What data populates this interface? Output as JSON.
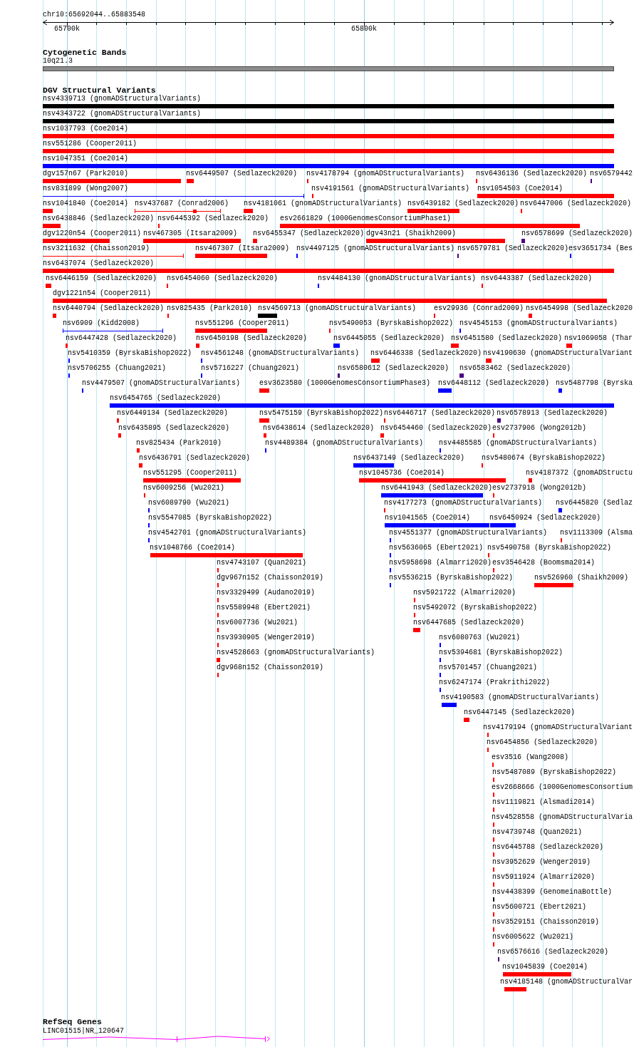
{
  "ruler": {
    "position": "chr10:65692044..65883548",
    "tick_labels": [
      "65700k",
      "65800k"
    ]
  },
  "cytogenetic_bands": {
    "title": "Cytogenetic Bands",
    "band": {
      "label": "10q21.3"
    }
  },
  "dgv_structural_variants": {
    "title": "DGV Structural Variants",
    "rows": [
      {
        "features": [
          {
            "label": "nsv4339713 (gnomADStructuralVariants)",
            "kind": "bar",
            "color": "#000000"
          }
        ]
      },
      {
        "features": [
          {
            "label": "nsv4343722 (gnomADStructuralVariants)",
            "kind": "bar",
            "color": "#000000"
          }
        ]
      },
      {
        "features": [
          {
            "label": "nsv1037793 (Coe2014)",
            "kind": "bar",
            "color": "#ff0000"
          }
        ]
      },
      {
        "features": [
          {
            "label": "nsv551286 (Cooper2011)",
            "kind": "bar",
            "color": "#ff0000"
          }
        ]
      },
      {
        "features": [
          {
            "label": "nsv1047351 (Coe2014)",
            "kind": "bar",
            "color": "#0000ff"
          }
        ]
      },
      {
        "features": [
          {
            "label": "dgv157n67 (Park2010)",
            "kind": "bar",
            "color": "#ff0000"
          },
          {
            "label": "nsv6449507 (Sedlazeck2020)",
            "kind": "bar",
            "color": "#ff0000"
          },
          {
            "label": "nsv4178794 (gnomADStructuralVariants)",
            "kind": "bar",
            "color": "#ff0000"
          },
          {
            "label": "nsv6436136 (Sedlazeck2020)",
            "kind": "bar",
            "color": "#ff0000"
          },
          {
            "label": "nsv6579442",
            "kind": "bar",
            "color": "#4b0082"
          }
        ]
      },
      {
        "features": [
          {
            "label": "nsv831899 (Wong2007)",
            "kind": "span",
            "color": "#0000ff"
          },
          {
            "label": "nsv4191561 (gnomADStructuralVariants)",
            "kind": "bar",
            "color": "#ff0000"
          },
          {
            "label": "nsv1054503 (Coe2014)",
            "kind": "bar",
            "color": "#ff0000"
          }
        ]
      },
      {
        "features": [
          {
            "label": "nsv1041840 (Coe2014)",
            "kind": "bar",
            "color": "#ff0000"
          },
          {
            "label": "nsv437687 (Conrad2006)",
            "kind": "span",
            "color": "#ff0000"
          },
          {
            "label": "nsv4181061 (gnomADStructuralVariants)",
            "kind": "bar",
            "color": "#ff0000"
          },
          {
            "label": "nsv6439182 (Sedlazeck2020)",
            "kind": "bar",
            "color": "#ff0000"
          },
          {
            "label": "nsv6447006 (Sedlazeck2020)",
            "kind": "bar",
            "color": "#ff0000"
          }
        ]
      },
      {
        "features": [
          {
            "label": "nsv6438846 (Sedlazeck2020)",
            "kind": "bar",
            "color": "#ff0000"
          },
          {
            "label": "nsv6445392 (Sedlazeck2020)",
            "kind": "bar",
            "color": "#ff0000"
          },
          {
            "label": "esv2661829 (1000GenomesConsortiumPhase1)",
            "kind": "bar",
            "color": "#ff0000"
          }
        ]
      },
      {
        "features": [
          {
            "label": "dgv1220n54 (Cooper2011)",
            "kind": "bar",
            "color": "#ff0000"
          },
          {
            "label": "nsv467305 (Itsara2009)",
            "kind": "bar",
            "color": "#ff0000"
          },
          {
            "label": "nsv6455347 (Sedlazeck2020)",
            "kind": "bar",
            "color": "#ff0000"
          },
          {
            "label": "dgv43n21 (Shaikh2009)",
            "kind": "bar",
            "color": "#ff0000"
          },
          {
            "label": "nsv6578699 (Sedlazeck2020)",
            "kind": "bar",
            "color": "#4b0082"
          }
        ]
      },
      {
        "features": [
          {
            "label": "nsv3211632 (Chaisson2019)",
            "kind": "span",
            "color": "#ff0000"
          },
          {
            "label": "nsv467307 (Itsara2009)",
            "kind": "bar",
            "color": "#ff0000"
          },
          {
            "label": "nsv4497125 (gnomADStructuralVariants)",
            "kind": "bar",
            "color": "#0000ff"
          },
          {
            "label": "nsv6579781 (Sedlazeck2020)",
            "kind": "bar",
            "color": "#4b0082"
          },
          {
            "label": "esv3651734 (Bes",
            "kind": "bar",
            "color": "#0000ff"
          }
        ]
      },
      {
        "features": [
          {
            "label": "nsv6437074 (Sedlazeck2020)",
            "kind": "bar",
            "color": "#ff0000"
          }
        ]
      },
      {
        "features": [
          {
            "label": "nsv6446159 (Sedlazeck2020)",
            "kind": "bar",
            "color": "#ff0000"
          },
          {
            "label": "nsv6454060 (Sedlazeck2020)",
            "kind": "bar",
            "color": "#ff0000"
          },
          {
            "label": "nsv4484130 (gnomADStructuralVariants)",
            "kind": "bar",
            "color": "#0000ff"
          },
          {
            "label": "nsv6443387 (Sedlazeck2020)",
            "kind": "bar",
            "color": "#ff0000"
          }
        ]
      },
      {
        "features": [
          {
            "label": "dgv1221n54 (Cooper2011)",
            "kind": "bar",
            "color": "#ff0000"
          }
        ]
      },
      {
        "features": [
          {
            "label": "nsv6440794 (Sedlazeck2020)",
            "kind": "bar",
            "color": "#ff0000"
          },
          {
            "label": "nsv825435 (Park2010)",
            "kind": "bar",
            "color": "#ff0000"
          },
          {
            "label": "nsv4569713 (gnomADStructuralVariants)",
            "kind": "bar",
            "color": "#000000"
          },
          {
            "label": "esv29936 (Conrad2009)",
            "kind": "bar",
            "color": "#ff0000"
          },
          {
            "label": "nsv6454998 (Sedlazeck2020",
            "kind": "bar",
            "color": "#ff0000"
          }
        ]
      },
      {
        "features": [
          {
            "label": "nsv6909 (Kidd2008)",
            "kind": "span",
            "color": "#0000ff"
          },
          {
            "label": "nsv551296 (Cooper2011)",
            "kind": "bar",
            "color": "#ff0000"
          },
          {
            "label": "nsv5490053 (ByrskaBishop2022)",
            "kind": "bar",
            "color": "#ff0000"
          },
          {
            "label": "nsv4545153 (gnomADStructuralVariants)",
            "kind": "bar",
            "color": "#0000ff"
          }
        ]
      },
      {
        "features": [
          {
            "label": "nsv6447428 (Sedlazeck2020)",
            "kind": "bar",
            "color": "#ff0000"
          },
          {
            "label": "nsv6450198 (Sedlazeck2020)",
            "kind": "bar",
            "color": "#ff0000"
          },
          {
            "label": "nsv6445055 (Sedlazeck2020)",
            "kind": "bar",
            "color": "#0000ff"
          },
          {
            "label": "nsv6451580 (Sedlazeck2020)",
            "kind": "bar",
            "color": "#ff0000"
          },
          {
            "label": "nsv1069058 (Thar",
            "kind": "bar",
            "color": "#ff0000"
          }
        ]
      },
      {
        "features": [
          {
            "label": "nsv5410359 (ByrskaBishop2022)",
            "kind": "bar",
            "color": "#0000ff"
          },
          {
            "label": "nsv4561248 (gnomADStructuralVariants)",
            "kind": "bar",
            "color": "#0000ff"
          },
          {
            "label": "nsv6446338 (Sedlazeck2020)",
            "kind": "bar",
            "color": "#ff0000"
          },
          {
            "label": "nsv4190630 (gnomADStructuralVariant",
            "kind": "bar",
            "color": "#ff0000"
          }
        ]
      },
      {
        "features": [
          {
            "label": "nsv5706255 (Chuang2021)",
            "kind": "bar",
            "color": "#0000ff"
          },
          {
            "label": "nsv5716227 (Chuang2021)",
            "kind": "bar",
            "color": "#0000ff"
          },
          {
            "label": "nsv6580612 (Sedlazeck2020)",
            "kind": "bar",
            "color": "#4b0082"
          },
          {
            "label": "nsv6583462 (Sedlazeck2020)",
            "kind": "bar",
            "color": "#4b0082"
          }
        ]
      },
      {
        "features": [
          {
            "label": "nsv4479507 (gnomADStructuralVariants)",
            "kind": "bar",
            "color": "#0000ff"
          },
          {
            "label": "esv3623580 (1000GenomesConsortiumPhase3)",
            "kind": "bar",
            "color": "#ff0000"
          },
          {
            "label": "nsv6448112 (Sedlazeck2020)",
            "kind": "bar",
            "color": "#0000ff"
          },
          {
            "label": "nsv5487798 (Byrska",
            "kind": "bar",
            "color": "#0000ff"
          }
        ]
      },
      {
        "features": [
          {
            "label": "nsv6454765 (Sedlazeck2020)",
            "kind": "bar",
            "color": "#0000ff"
          }
        ]
      },
      {
        "features": [
          {
            "label": "nsv6449134 (Sedlazeck2020)",
            "kind": "bar",
            "color": "#ff0000"
          },
          {
            "label": "nsv5475159 (ByrskaBishop2022)",
            "kind": "bar",
            "color": "#ff0000"
          },
          {
            "label": "nsv6446717 (Sedlazeck2020)",
            "kind": "bar",
            "color": "#ff0000"
          },
          {
            "label": "nsv6578913 (Sedlazeck2020)",
            "kind": "bar",
            "color": "#4b0082"
          }
        ]
      },
      {
        "features": [
          {
            "label": "nsv6435895 (Sedlazeck2020)",
            "kind": "bar",
            "color": "#ff0000"
          },
          {
            "label": "nsv6438614 (Sedlazeck2020)",
            "kind": "bar",
            "color": "#ff0000"
          },
          {
            "label": "nsv6454460 (Sedlazeck2020)",
            "kind": "bar",
            "color": "#ff0000"
          },
          {
            "label": "esv2737906 (Wong2012b)",
            "kind": "bar",
            "color": "#ff0000"
          }
        ]
      },
      {
        "features": [
          {
            "label": "nsv825434 (Park2010)",
            "kind": "bar",
            "color": "#ff0000"
          },
          {
            "label": "nsv4489384 (gnomADStructuralVariants)",
            "kind": "bar",
            "color": "#0000ff"
          },
          {
            "label": "nsv4485585 (gnomADStructuralVariants)",
            "kind": "bar",
            "color": "#0000ff"
          }
        ]
      },
      {
        "features": [
          {
            "label": "nsv6436791 (Sedlazeck2020)",
            "kind": "bar",
            "color": "#ff0000"
          },
          {
            "label": "nsv6437149 (Sedlazeck2020)",
            "kind": "bar",
            "color": "#0000ff"
          },
          {
            "label": "nsv5480674 (ByrskaBishop2022)",
            "kind": "bar",
            "color": "#ff0000"
          }
        ]
      },
      {
        "features": [
          {
            "label": "nsv551295 (Cooper2011)",
            "kind": "bar",
            "color": "#ff0000"
          },
          {
            "label": "nsv1045736 (Coe2014)",
            "kind": "bar",
            "color": "#ff0000"
          },
          {
            "label": "nsv4187372 (gnomADStructu",
            "kind": "bar",
            "color": "#ff0000"
          }
        ]
      },
      {
        "features": [
          {
            "label": "nsv6009256 (Wu2021)",
            "kind": "bar",
            "color": "#ff0000"
          },
          {
            "label": "nsv6441943 (Sedlazeck2020)",
            "kind": "bar",
            "color": "#0000ff"
          },
          {
            "label": "esv2737918 (Wong2012b)",
            "kind": "bar",
            "color": "#ff0000"
          }
        ]
      },
      {
        "features": [
          {
            "label": "nsv6089790 (Wu2021)",
            "kind": "bar",
            "color": "#0000ff"
          },
          {
            "label": "nsv4177273 (gnomADStructuralVariants)",
            "kind": "bar",
            "color": "#ff0000"
          },
          {
            "label": "nsv6445820 (Sedlaz",
            "kind": "bar",
            "color": "#0000ff"
          }
        ]
      },
      {
        "features": [
          {
            "label": "nsv5547085 (ByrskaBishop2022)",
            "kind": "bar",
            "color": "#0000ff"
          },
          {
            "label": "nsv1041565 (Coe2014)",
            "kind": "bar",
            "color": "#0000ff"
          },
          {
            "label": "nsv6450924 (Sedlazeck2020)",
            "kind": "bar",
            "color": "#0000ff"
          }
        ]
      },
      {
        "features": [
          {
            "label": "nsv4542701 (gnomADStructuralVariants)",
            "kind": "bar",
            "color": "#0000ff"
          },
          {
            "label": "nsv4551377 (gnomADStructuralVariants)",
            "kind": "bar",
            "color": "#0000ff"
          },
          {
            "label": "nsv1113309 (Alsma",
            "kind": "bar",
            "color": "#ff0000"
          }
        ]
      },
      {
        "features": [
          {
            "label": "nsv1048766 (Coe2014)",
            "kind": "bar",
            "color": "#ff0000"
          },
          {
            "label": "nsv5636065 (Ebert2021)",
            "kind": "bar",
            "color": "#0000ff"
          },
          {
            "label": "nsv5490758 (ByrskaBishop2022)",
            "kind": "bar",
            "color": "#ff0000"
          }
        ]
      },
      {
        "features": [
          {
            "label": "nsv4743107 (Quan2021)",
            "kind": "bar",
            "color": "#ff0000"
          },
          {
            "label": "nsv5958698 (Almarri2020)",
            "kind": "bar",
            "color": "#0000ff"
          },
          {
            "label": "esv3546428 (Boomsma2014)",
            "kind": "bar",
            "color": "#ff0000"
          }
        ]
      },
      {
        "features": [
          {
            "label": "dgv967n152 (Chaisson2019)",
            "kind": "bar",
            "color": "#ff0000"
          },
          {
            "label": "nsv5536215 (ByrskaBishop2022)",
            "kind": "bar",
            "color": "#0000ff"
          },
          {
            "label": "nsv526960 (Shaikh2009)",
            "kind": "bar",
            "color": "#ff0000"
          }
        ]
      },
      {
        "features": [
          {
            "label": "nsv3329499 (Audano2019)",
            "kind": "bar",
            "color": "#ff0000"
          },
          {
            "label": "nsv5921722 (Almarri2020)",
            "kind": "bar",
            "color": "#ff0000"
          }
        ]
      },
      {
        "features": [
          {
            "label": "nsv5589948 (Ebert2021)",
            "kind": "bar",
            "color": "#ff0000"
          },
          {
            "label": "nsv5492072 (ByrskaBishop2022)",
            "kind": "bar",
            "color": "#ff0000"
          }
        ]
      },
      {
        "features": [
          {
            "label": "nsv6007736 (Wu2021)",
            "kind": "bar",
            "color": "#ff0000"
          },
          {
            "label": "nsv6447685 (Sedlazeck2020)",
            "kind": "bar",
            "color": "#ff0000"
          }
        ]
      },
      {
        "features": [
          {
            "label": "nsv3930905 (Wenger2019)",
            "kind": "bar",
            "color": "#ff0000"
          },
          {
            "label": "nsv6080763 (Wu2021)",
            "kind": "bar",
            "color": "#0000ff"
          }
        ]
      },
      {
        "features": [
          {
            "label": "nsv4528663 (gnomADStructuralVariants)",
            "kind": "bar",
            "color": "#ff0000"
          },
          {
            "label": "nsv5394681 (ByrskaBishop2022)",
            "kind": "bar",
            "color": "#0000ff"
          }
        ]
      },
      {
        "features": [
          {
            "label": "dgv968n152 (Chaisson2019)",
            "kind": "bar",
            "color": "#ff0000"
          },
          {
            "label": "nsv5701457 (Chuang2021)",
            "kind": "bar",
            "color": "#0000ff"
          }
        ]
      },
      {
        "features": [
          {
            "label": "nsv6247174 (Prakrithi2022)",
            "kind": "bar",
            "color": "#0000ff"
          }
        ]
      },
      {
        "features": [
          {
            "label": "nsv4190583 (gnomADStructuralVariants)",
            "kind": "bar",
            "color": "#0000ff"
          }
        ]
      },
      {
        "features": [
          {
            "label": "nsv6447145 (Sedlazeck2020)",
            "kind": "bar",
            "color": "#ff0000"
          }
        ]
      },
      {
        "features": [
          {
            "label": "nsv4179194 (gnomADStructuralVariant",
            "kind": "bar",
            "color": "#ff0000"
          }
        ]
      },
      {
        "features": [
          {
            "label": "nsv6454856 (Sedlazeck2020)",
            "kind": "bar",
            "color": "#ff0000"
          }
        ]
      },
      {
        "features": [
          {
            "label": "esv3516 (Wang2008)",
            "kind": "bar",
            "color": "#ff0000"
          }
        ]
      },
      {
        "features": [
          {
            "label": "nsv5487089 (ByrskaBishop2022)",
            "kind": "bar",
            "color": "#ff0000"
          }
        ]
      },
      {
        "features": [
          {
            "label": "esv2668666 (1000GenomesConsortium",
            "kind": "bar",
            "color": "#ff0000"
          }
        ]
      },
      {
        "features": [
          {
            "label": "nsv1119821 (Alsmadi2014)",
            "kind": "bar",
            "color": "#ff0000"
          }
        ]
      },
      {
        "features": [
          {
            "label": "nsv4528558 (gnomADStructuralVaria",
            "kind": "bar",
            "color": "#ff0000"
          }
        ]
      },
      {
        "features": [
          {
            "label": "nsv4739748 (Quan2021)",
            "kind": "bar",
            "color": "#ff0000"
          }
        ]
      },
      {
        "features": [
          {
            "label": "nsv6445788 (Sedlazeck2020)",
            "kind": "bar",
            "color": "#ff0000"
          }
        ]
      },
      {
        "features": [
          {
            "label": "nsv3952629 (Wenger2019)",
            "kind": "bar",
            "color": "#ff0000"
          }
        ]
      },
      {
        "features": [
          {
            "label": "nsv5911924 (Almarri2020)",
            "kind": "bar",
            "color": "#ff0000"
          }
        ]
      },
      {
        "features": [
          {
            "label": "nsv4438399 (GenomeinaBottle)",
            "kind": "bar",
            "color": "#000000"
          }
        ]
      },
      {
        "features": [
          {
            "label": "nsv5600721 (Ebert2021)",
            "kind": "bar",
            "color": "#ff0000"
          }
        ]
      },
      {
        "features": [
          {
            "label": "nsv3529151 (Chaisson2019)",
            "kind": "bar",
            "color": "#ff0000"
          }
        ]
      },
      {
        "features": [
          {
            "label": "nsv6005622 (Wu2021)",
            "kind": "bar",
            "color": "#ff0000"
          }
        ]
      },
      {
        "features": [
          {
            "label": "nsv6576616 (Sedlazeck2020)",
            "kind": "bar",
            "color": "#4b0082"
          }
        ]
      },
      {
        "features": [
          {
            "label": "nsv1045839 (Coe2014)",
            "kind": "bar",
            "color": "#ff0000"
          }
        ]
      },
      {
        "features": [
          {
            "label": "nsv4185148 (gnomADStructuralVar",
            "kind": "bar",
            "color": "#ff0000"
          }
        ]
      }
    ]
  },
  "refseq_genes": {
    "title": "RefSeq Genes",
    "gene": {
      "label": "LINC01515|NR_120647"
    }
  }
}
